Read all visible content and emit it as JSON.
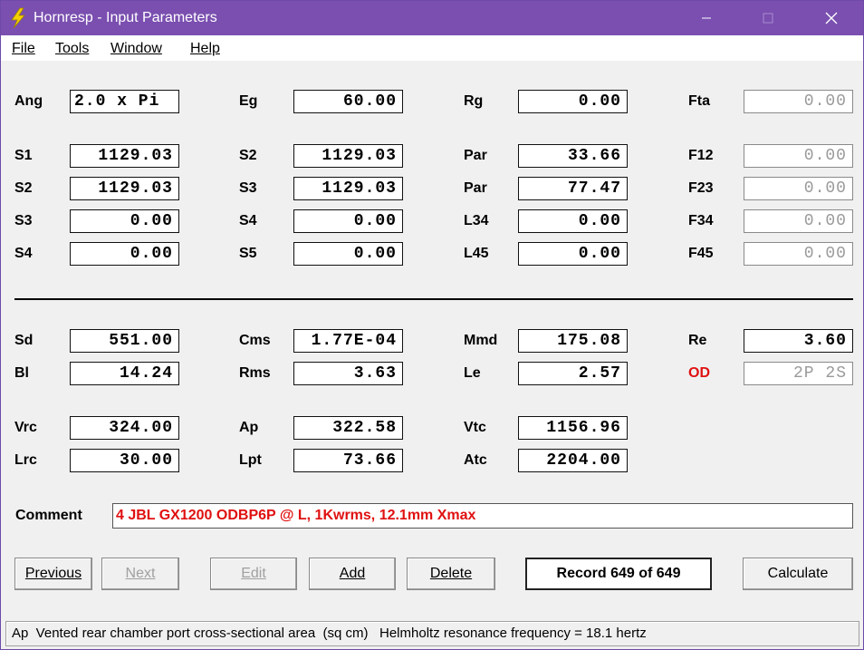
{
  "window": {
    "title": "Hornresp - Input Parameters",
    "accent_color": "#7a4fb0",
    "icon": "lightning-icon"
  },
  "menu": {
    "file": "File",
    "tools": "Tools",
    "window": "Window",
    "help": "Help"
  },
  "params": {
    "ang": {
      "label": "Ang",
      "value": "2.0 x Pi"
    },
    "eg": {
      "label": "Eg",
      "value": "60.00"
    },
    "rg": {
      "label": "Rg",
      "value": "0.00"
    },
    "fta": {
      "label": "Fta",
      "value": "0.00"
    },
    "s1": {
      "label": "S1",
      "value": "1129.03"
    },
    "s2a": {
      "label": "S2",
      "value": "1129.03"
    },
    "par1": {
      "label": "Par",
      "value": "33.66"
    },
    "f12": {
      "label": "F12",
      "value": "0.00"
    },
    "s2": {
      "label": "S2",
      "value": "1129.03"
    },
    "s3a": {
      "label": "S3",
      "value": "1129.03"
    },
    "par2": {
      "label": "Par",
      "value": "77.47"
    },
    "f23": {
      "label": "F23",
      "value": "0.00"
    },
    "s3": {
      "label": "S3",
      "value": "0.00"
    },
    "s4a": {
      "label": "S4",
      "value": "0.00"
    },
    "l34": {
      "label": "L34",
      "value": "0.00"
    },
    "f34": {
      "label": "F34",
      "value": "0.00"
    },
    "s4": {
      "label": "S4",
      "value": "0.00"
    },
    "s5": {
      "label": "S5",
      "value": "0.00"
    },
    "l45": {
      "label": "L45",
      "value": "0.00"
    },
    "f45": {
      "label": "F45",
      "value": "0.00"
    },
    "sd": {
      "label": "Sd",
      "value": "551.00"
    },
    "cms": {
      "label": "Cms",
      "value": "1.77E-04"
    },
    "mmd": {
      "label": "Mmd",
      "value": "175.08"
    },
    "re": {
      "label": "Re",
      "value": "3.60"
    },
    "bl": {
      "label": "Bl",
      "value": "14.24"
    },
    "rms": {
      "label": "Rms",
      "value": "3.63"
    },
    "le": {
      "label": "Le",
      "value": "2.57"
    },
    "od": {
      "label": "OD",
      "value": "2P 2S"
    },
    "vrc": {
      "label": "Vrc",
      "value": "324.00"
    },
    "ap": {
      "label": "Ap",
      "value": "322.58"
    },
    "vtc": {
      "label": "Vtc",
      "value": "1156.96"
    },
    "lrc": {
      "label": "Lrc",
      "value": "30.00"
    },
    "lpt": {
      "label": "Lpt",
      "value": "73.66"
    },
    "atc": {
      "label": "Atc",
      "value": "2204.00"
    }
  },
  "comment": {
    "label": "Comment",
    "value": "4 JBL GX1200 ODBP6P @ L, 1Kwrms, 12.1mm Xmax",
    "color": "#e01010"
  },
  "buttons": {
    "previous": "Previous",
    "next": "Next",
    "edit": "Edit",
    "add": "Add",
    "delete": "Delete",
    "record": "Record 649 of 649",
    "calculate": "Calculate"
  },
  "status": {
    "text": "Ap  Vented rear chamber port cross-sectional area  (sq cm)   Helmholtz resonance frequency = 18.1 hertz"
  }
}
